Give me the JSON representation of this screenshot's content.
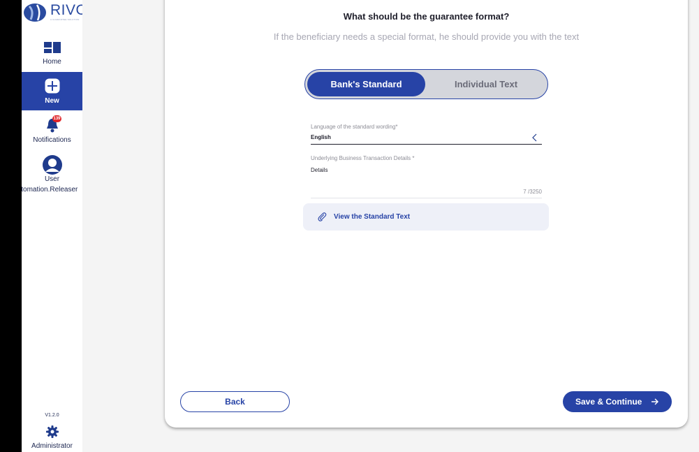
{
  "app": {
    "logo_text": "RIVO",
    "logo_tagline": "A GUARANTEE SOLUTION"
  },
  "sidebar": {
    "home": {
      "label": "Home",
      "icon": "home-dashboard-icon"
    },
    "new": {
      "label": "New",
      "icon": "plus-icon",
      "active": true
    },
    "notifications": {
      "label": "Notifications",
      "icon": "bell-icon",
      "badge": "139"
    },
    "user": {
      "label": "User",
      "sublabel": "Automation.Releaser",
      "icon": "user-avatar-icon"
    },
    "version": "V1.2.0",
    "admin": {
      "label": "Administrator",
      "icon": "gear-icon"
    }
  },
  "main": {
    "title": "What should be the guarantee format?",
    "subtitle": "If the beneficiary needs a special format, he should provide you with the text",
    "format_toggle": {
      "options": [
        "Bank's Standard",
        "Individual Text"
      ],
      "selected": "Bank's Standard"
    },
    "language": {
      "label": "Language of the standard wording*",
      "value": "English"
    },
    "details": {
      "label": "Underlying Business Transaction Details *",
      "value": "Details",
      "counter": "7 /3250"
    },
    "view_standard": {
      "label": "View the Standard Text",
      "icon": "paperclip-icon"
    },
    "back_button": "Back",
    "save_button": "Save & Continue"
  },
  "colors": {
    "primary": "#2743a6",
    "badge": "#e0262a",
    "toggle_bg": "#d4d6dc",
    "view_bg": "#eef0f8"
  }
}
